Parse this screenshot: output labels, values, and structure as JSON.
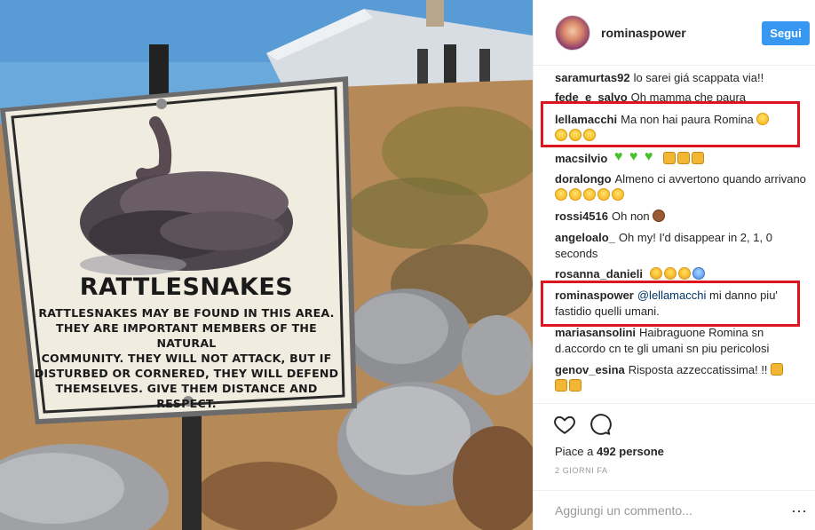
{
  "photo": {
    "sign": {
      "title": "RATTLESNAKES",
      "body_lines": [
        "RATTLESNAKES MAY BE FOUND IN THIS AREA.",
        "THEY ARE IMPORTANT MEMBERS OF THE NATURAL",
        "COMMUNITY. THEY WILL NOT ATTACK, BUT IF",
        "DISTURBED OR CORNERED, THEY WILL DEFEND",
        "THEMSELVES. GIVE THEM DISTANCE AND RESPECT."
      ]
    }
  },
  "header": {
    "username": "rominaspower",
    "follow_label": "Segui"
  },
  "comments": [
    {
      "user": "saramurtas92",
      "text": "lo sarei giá scappata via!!",
      "emojis": []
    },
    {
      "user": "fede_e_salvo",
      "text": "Oh mamma che paura",
      "emojis": []
    },
    {
      "user": "lellamacchi",
      "text": "Ma non hai paura Romina",
      "emojis": [
        "face",
        "face",
        "face",
        "face"
      ]
    },
    {
      "user": "macsilvio",
      "text": "",
      "emojis": [
        "heart",
        "heart",
        "heart",
        "hand",
        "hand",
        "hand"
      ]
    },
    {
      "user": "doralongo",
      "text": "Almeno ci avvertono quando arrivano",
      "emojis": [
        "face",
        "face",
        "face",
        "face",
        "face"
      ]
    },
    {
      "user": "rossi4516",
      "text": "Oh non",
      "emojis": [
        "monkey"
      ]
    },
    {
      "user": "angeloalo_",
      "text": "Oh my! I'd disappear in 2, 1, 0 seconds",
      "emojis": []
    },
    {
      "user": "rosanna_danieli",
      "text": "",
      "emojis": [
        "scream",
        "scream",
        "scream",
        "cold"
      ]
    },
    {
      "user": "rominaspower",
      "mention": "@lellamacchi",
      "text": "mi danno piu' fastidio quelli umani.",
      "emojis": []
    },
    {
      "user": "mariasansolini",
      "text": "Haibraguone Romina sn d.accordo cn te gli umani sn piu pericolosi",
      "emojis": []
    },
    {
      "user": "genov_esina",
      "text": "Risposta azzeccatissima! !!",
      "emojis": [
        "hand",
        "hand",
        "hand"
      ]
    }
  ],
  "actions": {
    "like_icon": "heart-outline-icon",
    "comment_icon": "comment-bubble-icon",
    "likes_prefix": "Piace a",
    "likes_count": "492 persone",
    "timestamp": "2 GIORNI FA"
  },
  "add_comment": {
    "placeholder": "Aggiungi un commento...",
    "more_label": "···"
  },
  "colors": {
    "follow_button": "#3897f0",
    "highlight_box": "#e0141e",
    "mention": "#003569"
  }
}
